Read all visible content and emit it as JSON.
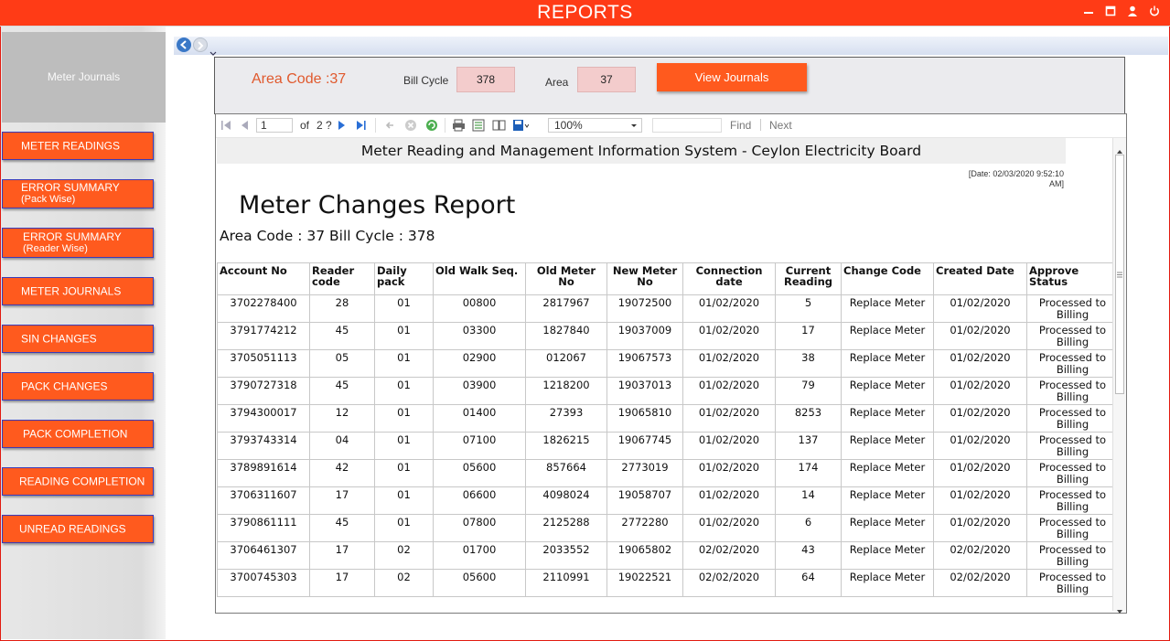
{
  "window": {
    "title": "REPORTS",
    "controls": [
      "minimize-icon",
      "maximize-icon",
      "user-icon",
      "power-icon"
    ],
    "accent": "#ff3b16"
  },
  "sidebar": {
    "header": "Meter Journals",
    "items": [
      {
        "label": "METER READINGS",
        "sub": ""
      },
      {
        "label": "ERROR SUMMARY",
        "sub": "(Pack Wise)"
      },
      {
        "label": "ERROR SUMMARY",
        "sub": "(Reader Wise)"
      },
      {
        "label": "METER JOURNALS",
        "sub": ""
      },
      {
        "label": "SIN CHANGES",
        "sub": ""
      },
      {
        "label": "PACK CHANGES",
        "sub": ""
      },
      {
        "label": "PACK COMPLETION",
        "sub": ""
      },
      {
        "label": "READING COMPLETION",
        "sub": ""
      },
      {
        "label": "UNREAD READINGS",
        "sub": ""
      }
    ]
  },
  "params": {
    "area_code_text": "Area Code :37",
    "bill_cycle_label": "Bill Cycle",
    "bill_cycle_value": "378",
    "area_label": "Area",
    "area_value": "37",
    "view_button": "View Journals"
  },
  "toolbar": {
    "page_current": "1",
    "page_of": "of",
    "page_total": "2 ?",
    "zoom": "100%",
    "find_label": "Find",
    "next_label": "Next"
  },
  "report": {
    "header": "Meter Reading and Management Information System - Ceylon Electricity Board",
    "date_line1": "[Date: 02/03/2020 9:52:10",
    "date_line2": "AM]",
    "title": "Meter Changes Report",
    "subtitle": "Area Code : 37 Bill Cycle : 378",
    "columns": [
      [
        "Account No",
        ""
      ],
      [
        "Reader",
        "code"
      ],
      [
        "Daily",
        "pack"
      ],
      [
        "Old Walk Seq.",
        ""
      ],
      [
        "Old Meter",
        "No"
      ],
      [
        "New Meter",
        "No"
      ],
      [
        "Connection",
        "date"
      ],
      [
        "Current",
        "Reading"
      ],
      [
        "Change Code",
        ""
      ],
      [
        "Created Date",
        ""
      ],
      [
        "Approve",
        "Status"
      ]
    ],
    "rows": [
      [
        "3702278400",
        "28",
        "01",
        "00800",
        "2817967",
        "19072500",
        "01/02/2020",
        "5",
        "Replace Meter",
        "01/02/2020",
        "Processed to",
        "Billing"
      ],
      [
        "3791774212",
        "45",
        "01",
        "03300",
        "1827840",
        "19037009",
        "01/02/2020",
        "17",
        "Replace Meter",
        "01/02/2020",
        "Processed to",
        "Billing"
      ],
      [
        "3705051113",
        "05",
        "01",
        "02900",
        "012067",
        "19067573",
        "01/02/2020",
        "38",
        "Replace Meter",
        "01/02/2020",
        "Processed to",
        "Billing"
      ],
      [
        "3790727318",
        "45",
        "01",
        "03900",
        "1218200",
        "19037013",
        "01/02/2020",
        "79",
        "Replace Meter",
        "01/02/2020",
        "Processed to",
        "Billing"
      ],
      [
        "3794300017",
        "12",
        "01",
        "01400",
        "27393",
        "19065810",
        "01/02/2020",
        "8253",
        "Replace Meter",
        "01/02/2020",
        "Processed to",
        "Billing"
      ],
      [
        "3793743314",
        "04",
        "01",
        "07100",
        "1826215",
        "19067745",
        "01/02/2020",
        "137",
        "Replace Meter",
        "01/02/2020",
        "Processed to",
        "Billing"
      ],
      [
        "3789891614",
        "42",
        "01",
        "05600",
        "857664",
        "2773019",
        "01/02/2020",
        "174",
        "Replace Meter",
        "01/02/2020",
        "Processed to",
        "Billing"
      ],
      [
        "3706311607",
        "17",
        "01",
        "06600",
        "4098024",
        "19058707",
        "01/02/2020",
        "14",
        "Replace Meter",
        "01/02/2020",
        "Processed to",
        "Billing"
      ],
      [
        "3790861111",
        "45",
        "01",
        "07800",
        "2125288",
        "2772280",
        "01/02/2020",
        "6",
        "Replace Meter",
        "01/02/2020",
        "Processed to",
        "Billing"
      ],
      [
        "3706461307",
        "17",
        "02",
        "01700",
        "2033552",
        "19065802",
        "02/02/2020",
        "43",
        "Replace Meter",
        "02/02/2020",
        "Processed to",
        "Billing"
      ],
      [
        "3700745303",
        "17",
        "02",
        "05600",
        "2110991",
        "19022521",
        "02/02/2020",
        "64",
        "Replace Meter",
        "02/02/2020",
        "Processed to",
        "Billing"
      ]
    ]
  }
}
